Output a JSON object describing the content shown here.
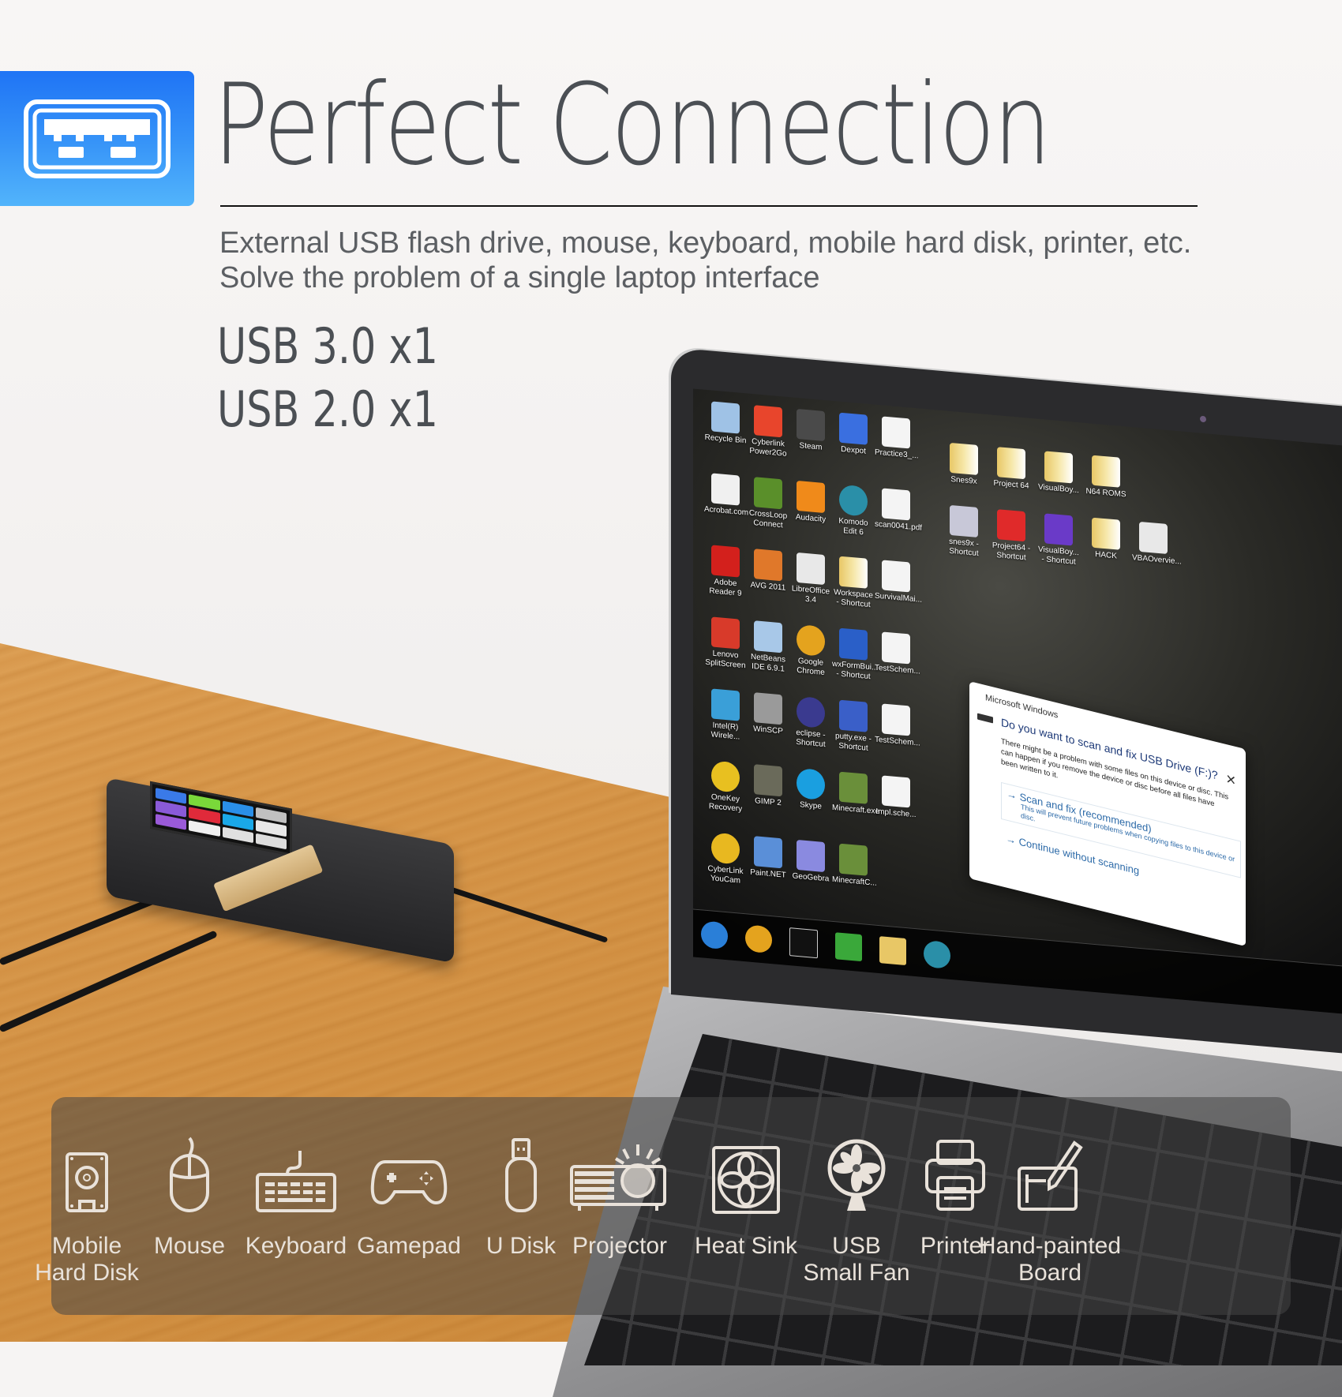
{
  "header": {
    "badge_icon": "usb-port-icon",
    "title": "Perfect Connection",
    "subtitle_line1": "External USB flash drive, mouse, keyboard, mobile hard disk, printer, etc.",
    "subtitle_line2": "Solve the problem of a single laptop interface",
    "brand_color": "#1f74f5"
  },
  "ports": [
    {
      "label": "USB 3.0 x1"
    },
    {
      "label": "USB 2.0 x1"
    }
  ],
  "laptop_screen": {
    "desktop_icons_left": [
      {
        "label": "Recycle Bin",
        "icon": "recycle-bin-icon",
        "color": "#9fc2e6"
      },
      {
        "label": "Cyberlink Power2Go",
        "icon": "power2go-icon",
        "color": "#e8452c"
      },
      {
        "label": "Steam",
        "icon": "steam-icon",
        "color": "#4a4a4a"
      },
      {
        "label": "Dexpot",
        "icon": "monitor-icon",
        "color": "#3a6fe0"
      },
      {
        "label": "Practice3_...",
        "icon": "pdf-icon",
        "color": "#f2f2f2"
      },
      {
        "label": "Acrobat.com",
        "icon": "acrobat-icon",
        "color": "#f0f0f0"
      },
      {
        "label": "CrossLoop Connect",
        "icon": "crossloop-icon",
        "color": "#5a8f2a"
      },
      {
        "label": "Audacity",
        "icon": "audacity-icon",
        "color": "#f08a1a"
      },
      {
        "label": "Komodo Edit 6",
        "icon": "komodo-icon",
        "color": "#2a8fa8"
      },
      {
        "label": "scan0041.pdf",
        "icon": "pdf-icon",
        "color": "#f2f2f2"
      },
      {
        "label": "Adobe Reader 9",
        "icon": "adobe-reader-icon",
        "color": "#d3201c"
      },
      {
        "label": "AVG 2011",
        "icon": "avg-icon",
        "color": "#e0782a"
      },
      {
        "label": "LibreOffice 3.4",
        "icon": "libreoffice-icon",
        "color": "#e8e8e8"
      },
      {
        "label": "Workspace - Shortcut",
        "icon": "folder-icon",
        "color": "#e8c766"
      },
      {
        "label": "SurvivalMai...",
        "icon": "document-icon",
        "color": "#f4f4f4"
      },
      {
        "label": "Lenovo SplitScreen",
        "icon": "splitscreen-icon",
        "color": "#d83a2a"
      },
      {
        "label": "NetBeans IDE 6.9.1",
        "icon": "netbeans-icon",
        "color": "#a8c8e8"
      },
      {
        "label": "Google Chrome",
        "icon": "chrome-icon",
        "color": "#e4a31e"
      },
      {
        "label": "wxFormBui... - Shortcut",
        "icon": "wxformbuilder-icon",
        "color": "#2a5fc8"
      },
      {
        "label": "TestSchem...",
        "icon": "document-icon",
        "color": "#f4f4f4"
      },
      {
        "label": "Intel(R) Wirele...",
        "icon": "wireless-icon",
        "color": "#3a9fd8"
      },
      {
        "label": "WinSCP",
        "icon": "winscp-icon",
        "color": "#9a9a9a"
      },
      {
        "label": "eclipse - Shortcut",
        "icon": "eclipse-icon",
        "color": "#3a3a8f"
      },
      {
        "label": "putty.exe - Shortcut",
        "icon": "putty-icon",
        "color": "#3a5fc8"
      },
      {
        "label": "TestSchem...",
        "icon": "document-icon",
        "color": "#f4f4f4"
      },
      {
        "label": "OneKey Recovery",
        "icon": "onekey-icon",
        "color": "#e8c020"
      },
      {
        "label": "GIMP 2",
        "icon": "gimp-icon",
        "color": "#6a6a5a"
      },
      {
        "label": "Skype",
        "icon": "skype-icon",
        "color": "#1a9fe0"
      },
      {
        "label": "Minecraft.exe",
        "icon": "minecraft-icon",
        "color": "#6a8f3a"
      },
      {
        "label": "Impl.sche...",
        "icon": "document-icon",
        "color": "#f4f4f4"
      },
      {
        "label": "CyberLink YouCam",
        "icon": "youcam-icon",
        "color": "#e8b820"
      },
      {
        "label": "Paint.NET",
        "icon": "paintnet-icon",
        "color": "#5a8fd8"
      },
      {
        "label": "GeoGebra",
        "icon": "geogebra-icon",
        "color": "#8a8ae0"
      },
      {
        "label": "MinecraftC...",
        "icon": "minecraft-icon",
        "color": "#6a8f3a"
      }
    ],
    "desktop_icons_right": [
      {
        "label": "Snes9x",
        "icon": "folder-icon",
        "color": "#e8c766"
      },
      {
        "label": "Project 64",
        "icon": "folder-icon",
        "color": "#e8c766"
      },
      {
        "label": "VisualBoy...",
        "icon": "folder-icon",
        "color": "#e8c766"
      },
      {
        "label": "N64 ROMS",
        "icon": "folder-icon",
        "color": "#e8c766"
      },
      {
        "label": "",
        "icon": "empty",
        "color": "transparent"
      },
      {
        "label": "snes9x - Shortcut",
        "icon": "snes-controller-icon",
        "color": "#c8c8d8"
      },
      {
        "label": "Project64 - Shortcut",
        "icon": "project64-icon",
        "color": "#e02a2a"
      },
      {
        "label": "VisualBoy... - Shortcut",
        "icon": "gameboy-advance-icon",
        "color": "#6a3ac8"
      },
      {
        "label": "HACK",
        "icon": "folder-icon",
        "color": "#e8c766"
      },
      {
        "label": "VBAOvervie...",
        "icon": "python-file-icon",
        "color": "#e8e8e8"
      }
    ],
    "taskbar": [
      {
        "icon": "windows-start-icon",
        "color": "#2a7fd8"
      },
      {
        "icon": "chrome-icon",
        "color": "#e4a31e"
      },
      {
        "icon": "command-prompt-icon",
        "color": "#111111"
      },
      {
        "icon": "network-monitor-icon",
        "color": "#3aa83a"
      },
      {
        "icon": "file-explorer-icon",
        "color": "#e8c766"
      },
      {
        "icon": "komodo-icon",
        "color": "#2a8fa8"
      }
    ],
    "dialog": {
      "caption": "Microsoft Windows",
      "title": "Do you want to scan and fix USB Drive (F:)?",
      "body": "There might be a problem with some files on this device or disc. This can happen if you remove the device or disc before all files have been written to it.",
      "option1_label": "→ Scan and fix (recommended)",
      "option1_sub": "This will prevent future problems when copying files to this device or disc.",
      "option2_label": "→ Continue without scanning",
      "close_label": "✕"
    }
  },
  "hub_keys": [
    "#3a7ae8",
    "#7ad83a",
    "#2a8fe8",
    "#c0c0c0",
    "#8a5ad8",
    "#e02a3a",
    "#1aa8e8",
    "#e8e8e8",
    "#9a5ad8",
    "#f0f0f0",
    "#e0e0e0",
    "#dddddd"
  ],
  "devices": [
    {
      "label1": "Mobile",
      "label2": "Hard Disk",
      "icon": "hard-disk-icon"
    },
    {
      "label1": "Mouse",
      "label2": "",
      "icon": "mouse-icon"
    },
    {
      "label1": "Keyboard",
      "label2": "",
      "icon": "keyboard-icon"
    },
    {
      "label1": "Gamepad",
      "label2": "",
      "icon": "gamepad-icon"
    },
    {
      "label1": "U Disk",
      "label2": "",
      "icon": "usb-stick-icon"
    },
    {
      "label1": "Projector",
      "label2": "",
      "icon": "projector-icon"
    },
    {
      "label1": "Heat Sink",
      "label2": "",
      "icon": "heat-sink-fan-icon"
    },
    {
      "label1": "USB",
      "label2": "Small Fan",
      "icon": "desk-fan-icon"
    },
    {
      "label1": "Printer",
      "label2": "",
      "icon": "printer-icon"
    },
    {
      "label1": "Hand-painted",
      "label2": "Board",
      "icon": "drawing-tablet-icon"
    }
  ]
}
